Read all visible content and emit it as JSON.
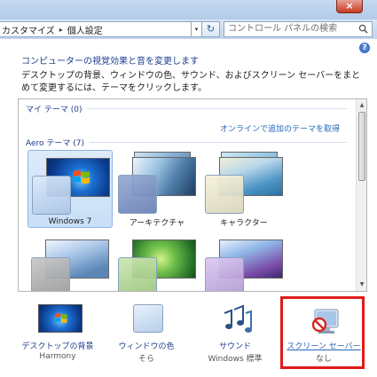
{
  "window": {
    "close_glyph": "×"
  },
  "address": {
    "segments": [
      "カスタマイズ",
      "個人設定"
    ],
    "separator": "▸",
    "dropdown_glyph": "▾",
    "refresh_glyph": "↻",
    "search_placeholder": "コントロール パネルの検索"
  },
  "help": {
    "glyph": "?"
  },
  "page": {
    "heading": "コンピューターの視覚効果と音を変更します",
    "description": "デスクトップの背景、ウィンドウの色、サウンド、およびスクリーン セーバーをまとめて変更するには、テーマをクリックします。"
  },
  "themes": {
    "my_themes_header": "マイ テーマ (0)",
    "online_link": "オンラインで追加のテーマを取得",
    "aero_header": "Aero テーマ (7)",
    "items": [
      {
        "label": "Windows 7",
        "selected": true
      },
      {
        "label": "アーキテクチャ",
        "selected": false
      },
      {
        "label": "キャラクター",
        "selected": false
      }
    ]
  },
  "bottom": {
    "items": [
      {
        "label": "デスクトップの背景",
        "sub": "Harmony"
      },
      {
        "label": "ウィンドウの色",
        "sub": "そら"
      },
      {
        "label": "サウンド",
        "sub": "Windows 標準"
      },
      {
        "label": "スクリーン セーバー",
        "sub": "なし"
      }
    ]
  },
  "colors": {
    "accent": "#1c3d8c",
    "link": "#2866b8",
    "highlight": "#e01a1a"
  }
}
